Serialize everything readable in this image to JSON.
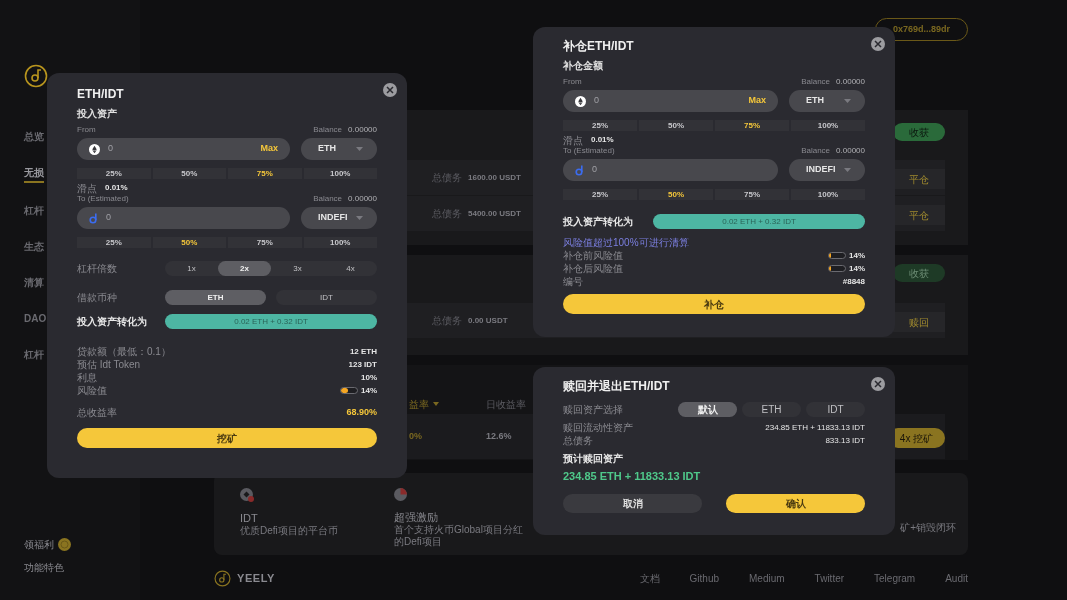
{
  "sidebar": {
    "items": [
      {
        "label": "总览",
        "selected": false
      },
      {
        "label": "无损",
        "selected": true
      },
      {
        "label": "杠杆",
        "selected": false
      },
      {
        "label": "生态",
        "selected": false
      },
      {
        "label": "清算",
        "selected": false
      },
      {
        "label": "DAO",
        "selected": false
      },
      {
        "label": "杠杆",
        "selected": false
      }
    ],
    "bottom": [
      {
        "label": "领福利",
        "kind": "coin"
      },
      {
        "label": "功能特色",
        "kind": "plain"
      }
    ]
  },
  "header": {
    "wallet": "0x769d...89dr"
  },
  "position_cards": [
    {
      "harvest": {
        "label": "收获",
        "disabled": false
      },
      "rows": [
        {
          "debt_label": "总债务",
          "debt": "1600.00 USDT",
          "action": "平仓"
        },
        {
          "debt_label": "总债务",
          "debt": "5400.00 USDT",
          "action": "平仓"
        }
      ]
    },
    {
      "harvest": {
        "label": "收获",
        "disabled": true
      },
      "rows": [
        {
          "debt_label": "总债务",
          "debt": "0.00 USDT",
          "action": "赎回"
        }
      ]
    }
  ],
  "pool_table": {
    "columns": [
      {
        "label": "益率",
        "sorted": true
      },
      {
        "label": "日收益率",
        "sorted": false
      }
    ],
    "rows": [
      {
        "apy": "0%",
        "daily": "12.6%",
        "action": "4x 挖矿"
      }
    ]
  },
  "features": [
    {
      "title": "IDT",
      "desc": "优质Defi项目的平台币",
      "kind": "coin"
    },
    {
      "title": "超强激励",
      "desc": "首个支持火币Global项目分红的Defi项目",
      "kind": "pie"
    },
    {
      "desc": "矿+销毁闭环",
      "kind": "none"
    }
  ],
  "footer": {
    "logo": "YEELY",
    "links": [
      "文档",
      "Github",
      "Medium",
      "Twitter",
      "Telegram",
      "Audit"
    ]
  },
  "mining_dialog": {
    "title": "ETH/IDT",
    "section": "投入资产",
    "from": {
      "label": "From",
      "balance_label": "Balance",
      "balance": "0.00000",
      "placeholder": "0",
      "max": "Max",
      "token": "ETH"
    },
    "from_percents": [
      {
        "label": "25%",
        "selected": false
      },
      {
        "label": "50%",
        "selected": false
      },
      {
        "label": "75%",
        "selected": true
      },
      {
        "label": "100%",
        "selected": false
      }
    ],
    "slippage_label": "滑点",
    "slippage": "0.01%",
    "to": {
      "label": "To (Estimated)",
      "balance_label": "Balance",
      "balance": "0.00000",
      "placeholder": "0",
      "token": "INDEFI"
    },
    "to_percents": [
      {
        "label": "25%",
        "selected": false
      },
      {
        "label": "50%",
        "selected": true
      },
      {
        "label": "75%",
        "selected": false
      },
      {
        "label": "100%",
        "selected": false
      }
    ],
    "leverage": {
      "label": "杠杆倍数",
      "options": [
        {
          "label": "1x",
          "selected": false
        },
        {
          "label": "2x",
          "selected": true
        },
        {
          "label": "3x",
          "selected": false
        },
        {
          "label": "4x",
          "selected": false
        }
      ]
    },
    "borrow": {
      "label": "借款币种",
      "options": [
        {
          "label": "ETH",
          "selected": true
        },
        {
          "label": "IDT",
          "selected": false
        }
      ]
    },
    "convert": {
      "label": "投入资产转化为",
      "value": "0.02 ETH + 0.32 IDT"
    },
    "details": [
      {
        "label": "贷款额（最低：0.1）",
        "value": "12 ETH",
        "kind": "text"
      },
      {
        "label": "预估 Idt Token",
        "value": "123 IDT",
        "kind": "text"
      },
      {
        "label": "利息",
        "value": "10%",
        "kind": "text"
      },
      {
        "label": "风险值",
        "value": "14%",
        "kind": "meter",
        "level": 0.45
      }
    ],
    "total": {
      "label": "总收益率",
      "value": "68.90%"
    },
    "submit": "挖矿"
  },
  "topup_dialog": {
    "title": "补仓ETH/IDT",
    "section": "补仓金额",
    "from": {
      "label": "From",
      "balance_label": "Balance",
      "balance": "0.00000",
      "placeholder": "0",
      "max": "Max",
      "token": "ETH"
    },
    "from_percents": [
      {
        "label": "25%",
        "selected": false
      },
      {
        "label": "50%",
        "selected": false
      },
      {
        "label": "75%",
        "selected": true
      },
      {
        "label": "100%",
        "selected": false
      }
    ],
    "slippage_label": "滑点",
    "slippage": "0.01%",
    "to": {
      "label": "To (Estimated)",
      "balance_label": "Balance",
      "balance": "0.00000",
      "placeholder": "0",
      "token": "INDEFI"
    },
    "to_percents": [
      {
        "label": "25%",
        "selected": false
      },
      {
        "label": "50%",
        "selected": true
      },
      {
        "label": "75%",
        "selected": false
      },
      {
        "label": "100%",
        "selected": false
      }
    ],
    "convert": {
      "label": "投入资产转化为",
      "value": "0.02 ETH + 0.32 IDT"
    },
    "warning": "风险值超过100%可进行清算",
    "details": [
      {
        "label": "补仓前风险值",
        "value": "14%",
        "kind": "meter",
        "level": 0.15
      },
      {
        "label": "补仓后风险值",
        "value": "14%",
        "kind": "meter",
        "level": 0.15
      },
      {
        "label": "编号",
        "value": "#8848",
        "kind": "text"
      }
    ],
    "submit": "补仓"
  },
  "redeem_dialog": {
    "title": "赎回并退出ETH/IDT",
    "asset_choice": {
      "label": "赎回资产选择",
      "options": [
        {
          "label": "默认",
          "selected": true
        },
        {
          "label": "ETH",
          "selected": false
        },
        {
          "label": "IDT",
          "selected": false
        }
      ]
    },
    "details": [
      {
        "label": "赎回流动性资产",
        "value": "234.85 ETH + 11833.13 IDT"
      },
      {
        "label": "总债务",
        "value": "833.13 IDT"
      }
    ],
    "estimate_label": "预计赎回资产",
    "estimate": "234.85 ETH + 11833.13 IDT",
    "buttons": [
      {
        "label": "取消",
        "kind": "secondary"
      },
      {
        "label": "确认",
        "kind": "primary"
      }
    ]
  }
}
